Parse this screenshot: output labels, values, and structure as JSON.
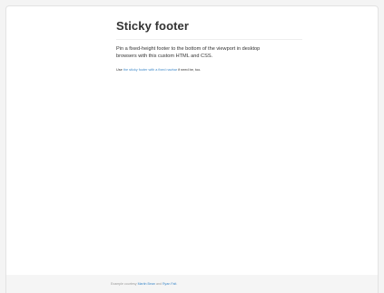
{
  "page": {
    "title": "Sticky footer",
    "lead_line1": "Pin a fixed-height footer to the bottom of the viewport in desktop",
    "lead_line2": "browsers with this custom HTML and CSS.",
    "note": {
      "prefix": "Use ",
      "link_text": "the sticky footer with a fixed navbar",
      "middle": " if need be, too."
    }
  },
  "footer": {
    "prefix": "Example courtesy ",
    "author1": "Martin Bean",
    "joiner": " and ",
    "author2": "Ryan Fait",
    "suffix": "."
  }
}
